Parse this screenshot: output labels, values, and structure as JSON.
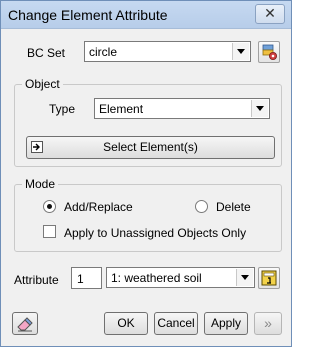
{
  "window": {
    "title": "Change Element Attribute",
    "close_glyph": "✕"
  },
  "bc_set": {
    "label": "BC Set",
    "value": "circle"
  },
  "object": {
    "group_label": "Object",
    "type_label": "Type",
    "type_value": "Element",
    "select_button": "Select Element(s)"
  },
  "mode": {
    "group_label": "Mode",
    "add_replace": "Add/Replace",
    "delete": "Delete",
    "apply_unassigned": "Apply to Unassigned Objects Only",
    "selected": "add_replace",
    "apply_unassigned_checked": false
  },
  "attribute": {
    "label": "Attribute",
    "number": "1",
    "value": "1: weathered soil"
  },
  "buttons": {
    "ok": "OK",
    "cancel": "Cancel",
    "apply": "Apply",
    "more": "»"
  },
  "colors": {
    "titlebar": "#c6d9f1",
    "window_bg": "#f0f0f0",
    "border": "#6f8fb8"
  }
}
